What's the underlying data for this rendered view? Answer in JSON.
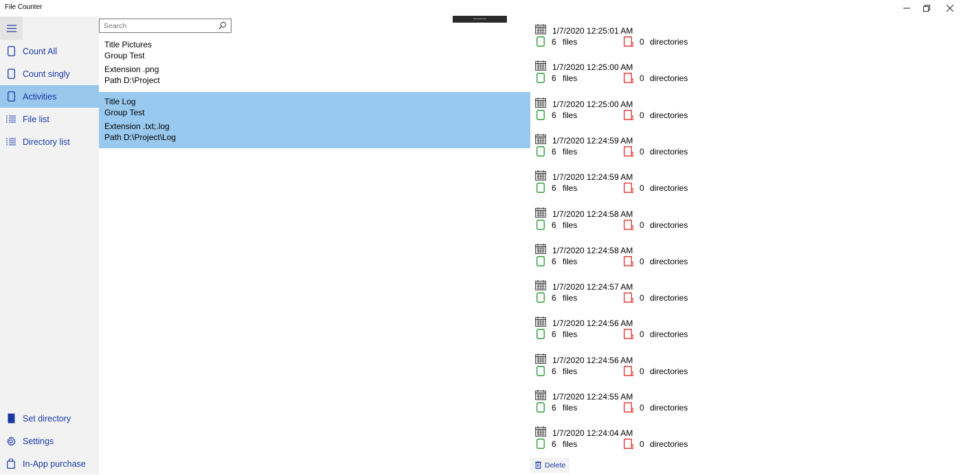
{
  "window": {
    "title": "File Counter",
    "minimize_glyph": "—",
    "maximize_glyph": "❐",
    "close_glyph": "✕"
  },
  "sidebar": {
    "menu_icon": "hamburger-icon",
    "items": [
      {
        "label": "Count All",
        "icon": "file-outline-icon",
        "selected": false
      },
      {
        "label": "Count  singly",
        "icon": "file-outline-icon",
        "selected": false
      },
      {
        "label": "Activities",
        "icon": "file-outline-icon",
        "selected": true
      },
      {
        "label": "File list",
        "icon": "list-icon",
        "selected": false
      },
      {
        "label": "Directory list",
        "icon": "list-icon",
        "selected": false
      }
    ],
    "bottom_items": [
      {
        "label": "Set directory",
        "icon": "folder-filled-icon"
      },
      {
        "label": "Settings",
        "icon": "gear-icon"
      },
      {
        "label": "In-App purchase",
        "icon": "shopping-bag-icon"
      }
    ]
  },
  "search": {
    "placeholder": "Search",
    "value": ""
  },
  "activities": [
    {
      "title": "Title Pictures",
      "group": "Group Test",
      "extension": "Extension .png",
      "path": "Path D:\\Project",
      "selected": false
    },
    {
      "title": "Title Log",
      "group": "Group Test",
      "extension": "Extension .txt;.log",
      "path": "Path D:\\Project\\Log",
      "selected": true
    }
  ],
  "results": [
    {
      "date": "1/7/2020 12:25:01 AM",
      "files": "6",
      "dirs": "0"
    },
    {
      "date": "1/7/2020 12:25:00 AM",
      "files": "6",
      "dirs": "0"
    },
    {
      "date": "1/7/2020 12:25:00 AM",
      "files": "6",
      "dirs": "0"
    },
    {
      "date": "1/7/2020 12:24:59 AM",
      "files": "6",
      "dirs": "0"
    },
    {
      "date": "1/7/2020 12:24:59 AM",
      "files": "6",
      "dirs": "0"
    },
    {
      "date": "1/7/2020 12:24:58 AM",
      "files": "6",
      "dirs": "0"
    },
    {
      "date": "1/7/2020 12:24:58 AM",
      "files": "6",
      "dirs": "0"
    },
    {
      "date": "1/7/2020 12:24:57 AM",
      "files": "6",
      "dirs": "0"
    },
    {
      "date": "1/7/2020 12:24:56 AM",
      "files": "6",
      "dirs": "0"
    },
    {
      "date": "1/7/2020 12:24:56 AM",
      "files": "6",
      "dirs": "0"
    },
    {
      "date": "1/7/2020 12:24:55 AM",
      "files": "6",
      "dirs": "0"
    },
    {
      "date": "1/7/2020 12:24:04 AM",
      "files": "6",
      "dirs": "0"
    }
  ],
  "result_labels": {
    "files": "files",
    "directories": "directories"
  },
  "delete_button": {
    "label": "Delete",
    "icon": "trash-icon"
  },
  "colors": {
    "accent": "#1b3aa8",
    "selection": "#99c9ee",
    "sidebar_bg": "#f2f2f2",
    "file_icon": "#2e9e3a",
    "dir_icon": "#e53935"
  }
}
